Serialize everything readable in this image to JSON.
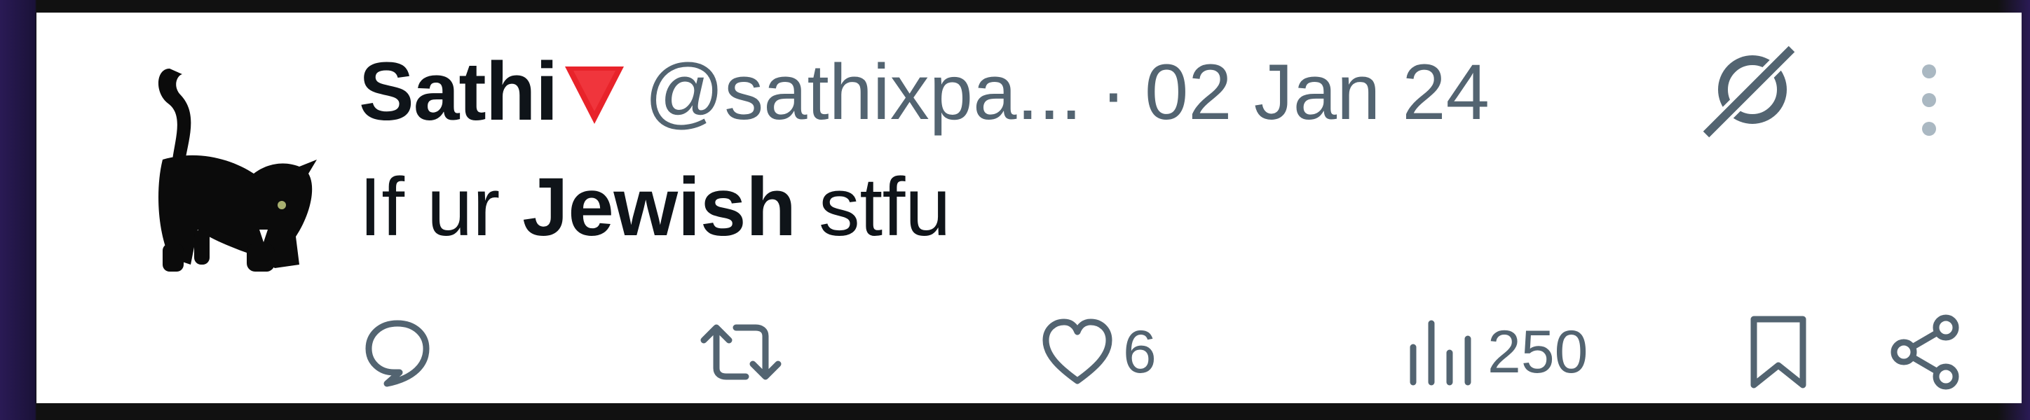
{
  "tweet": {
    "display_name": "Sathi",
    "handle": "@sathixpa...",
    "separator": "·",
    "date": "02 Jan 24",
    "text_before": "If ur ",
    "text_bold": "Jewish",
    "text_after": " stfu"
  },
  "actions": {
    "reply": {
      "icon": "reply-icon"
    },
    "retweet": {
      "icon": "retweet-icon"
    },
    "like": {
      "icon": "heart-icon",
      "count": "6"
    },
    "views": {
      "icon": "views-icon",
      "count": "250"
    },
    "bookmark": {
      "icon": "bookmark-icon"
    },
    "share": {
      "icon": "share-icon"
    }
  },
  "colors": {
    "text_primary": "#0f1419",
    "text_secondary": "#536471",
    "flag_red": "#e8232a",
    "background": "#ffffff"
  }
}
